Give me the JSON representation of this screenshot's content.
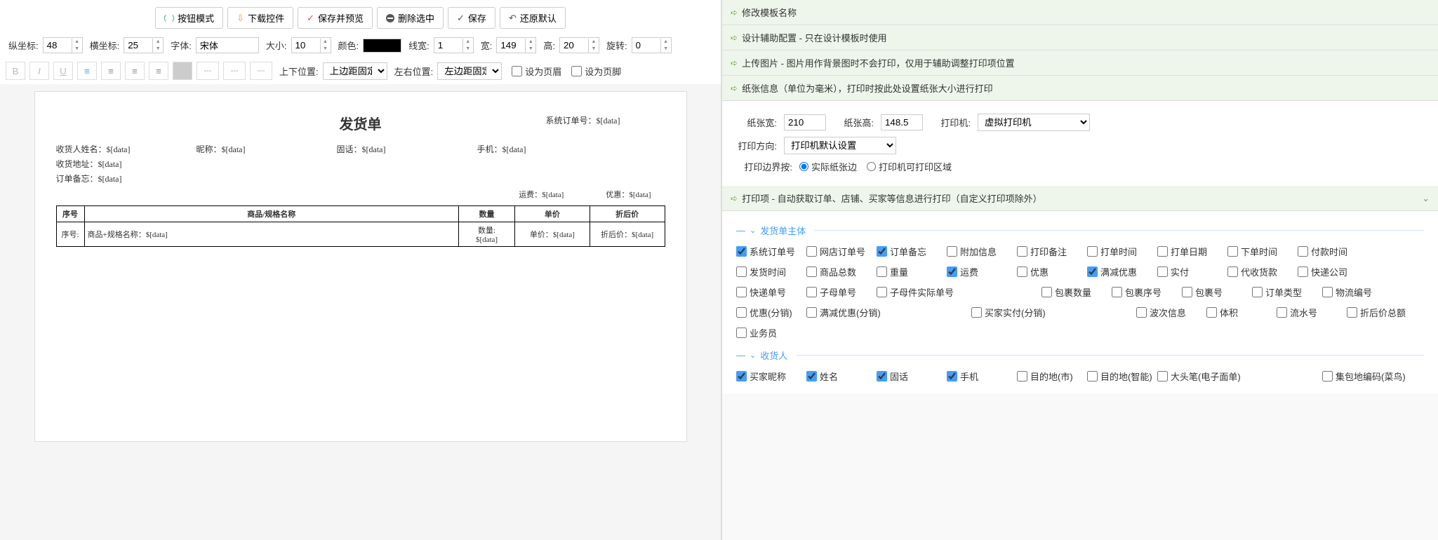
{
  "toolbar": {
    "button_mode": "按钮模式",
    "download_widget": "下载控件",
    "save_preview": "保存并预览",
    "delete_selected": "删除选中",
    "save": "保存",
    "restore_default": "还原默认"
  },
  "props": {
    "y_label": "纵坐标:",
    "y_value": "48",
    "x_label": "横坐标:",
    "x_value": "25",
    "font_label": "字体:",
    "font_value": "宋体",
    "size_label": "大小:",
    "size_value": "10",
    "color_label": "颜色:",
    "line_width_label": "线宽:",
    "line_width_value": "1",
    "width_label": "宽:",
    "width_value": "149",
    "height_label": "高:",
    "height_value": "20",
    "rotate_label": "旋转:",
    "rotate_value": "0",
    "vpos_label": "上下位置:",
    "vpos_value": "上边距固定",
    "hpos_label": "左右位置:",
    "hpos_value": "左边距固定",
    "set_header": "设为页眉",
    "set_footer": "设为页脚"
  },
  "doc": {
    "title": "发货单",
    "sys_order_label": "系统订单号：",
    "sys_order_val": "$[data]",
    "recipient_name_label": "收货人姓名：",
    "recipient_name_val": "$[data]",
    "nickname_label": "昵称：",
    "nickname_val": "$[data]",
    "tel_label": "固话：",
    "tel_val": "$[data]",
    "mobile_label": "手机：",
    "mobile_val": "$[data]",
    "address_label": "收货地址：",
    "address_val": "$[data]",
    "remark_label": "订单备忘：",
    "remark_val": "$[data]",
    "shipping_label": "运费：",
    "shipping_val": "$[data]",
    "discount_label": "优惠：",
    "discount_val": "$[data]",
    "col_idx": "序号",
    "col_name": "商品/规格名称",
    "col_qty": "数量",
    "col_price": "单价",
    "col_disc": "折后价",
    "row_idx_label": "序号:",
    "row_name_label": "商品+规格名称：",
    "row_name_val": "$[data]",
    "row_qty_label": "数量:",
    "row_qty_val": "$[data]",
    "row_price_label": "单价：",
    "row_price_val": "$[data]",
    "row_disc_label": "折后价：",
    "row_disc_val": "$[data]"
  },
  "sections": {
    "s1": "修改模板名称",
    "s2": "设计辅助配置 - 只在设计模板时使用",
    "s3": "上传图片 - 图片用作背景图时不会打印，仅用于辅助调整打印项位置",
    "s4": "纸张信息（单位为毫米），打印时按此处设置纸张大小进行打印",
    "s5": "打印项 - 自动获取订单、店铺、买家等信息进行打印（自定义打印项除外）"
  },
  "paper": {
    "width_label": "纸张宽:",
    "width_value": "210",
    "height_label": "纸张高:",
    "height_value": "148.5",
    "printer_label": "打印机:",
    "printer_value": "虚拟打印机",
    "orient_label": "打印方向:",
    "orient_value": "打印机默认设置",
    "margin_label": "打印边界按:",
    "margin_opt1": "实际纸张边",
    "margin_opt2": "打印机可打印区域"
  },
  "groups": {
    "g1": "发货单主体",
    "g2": "收货人"
  },
  "checks_main": [
    {
      "label": "系统订单号",
      "checked": true
    },
    {
      "label": "网店订单号",
      "checked": false
    },
    {
      "label": "订单备忘",
      "checked": true
    },
    {
      "label": "附加信息",
      "checked": false
    },
    {
      "label": "打印备注",
      "checked": false
    },
    {
      "label": "打单时间",
      "checked": false
    },
    {
      "label": "打单日期",
      "checked": false
    },
    {
      "label": "下单时间",
      "checked": false
    },
    {
      "label": "付款时间",
      "checked": false
    },
    {
      "label": "发货时间",
      "checked": false
    },
    {
      "label": "商品总数",
      "checked": false
    },
    {
      "label": "重量",
      "checked": false
    },
    {
      "label": "运费",
      "checked": true
    },
    {
      "label": "优惠",
      "checked": false
    },
    {
      "label": "满减优惠",
      "checked": true
    },
    {
      "label": "实付",
      "checked": false
    },
    {
      "label": "代收货款",
      "checked": false
    },
    {
      "label": "快递公司",
      "checked": false
    },
    {
      "label": "快递单号",
      "checked": false
    },
    {
      "label": "子母单号",
      "checked": false
    },
    {
      "label": "子母件实际单号",
      "checked": false,
      "wide": true
    },
    {
      "label": "",
      "skip": true
    },
    {
      "label": "包裹数量",
      "checked": false
    },
    {
      "label": "包裹序号",
      "checked": false
    },
    {
      "label": "包裹号",
      "checked": false
    },
    {
      "label": "订单类型",
      "checked": false
    },
    {
      "label": "物流编号",
      "checked": false
    },
    {
      "label": "优惠(分销)",
      "checked": false
    },
    {
      "label": "满减优惠(分销)",
      "checked": false,
      "wide": true
    },
    {
      "label": "",
      "skip": true
    },
    {
      "label": "买家实付(分销)",
      "checked": false,
      "wide": true
    },
    {
      "label": "",
      "skip": true
    },
    {
      "label": "波次信息",
      "checked": false
    },
    {
      "label": "体积",
      "checked": false
    },
    {
      "label": "流水号",
      "checked": false
    },
    {
      "label": "折后价总额",
      "checked": false
    },
    {
      "label": "业务员",
      "checked": false
    }
  ],
  "checks_recipient": [
    {
      "label": "买家昵称",
      "checked": true
    },
    {
      "label": "姓名",
      "checked": true
    },
    {
      "label": "固话",
      "checked": true
    },
    {
      "label": "手机",
      "checked": true
    },
    {
      "label": "目的地(市)",
      "checked": false
    },
    {
      "label": "目的地(智能)",
      "checked": false
    },
    {
      "label": "大头笔(电子面单)",
      "checked": false,
      "wide": true
    },
    {
      "label": "",
      "skip": true
    },
    {
      "label": "集包地编码(菜鸟)",
      "checked": false,
      "wide": true
    }
  ]
}
